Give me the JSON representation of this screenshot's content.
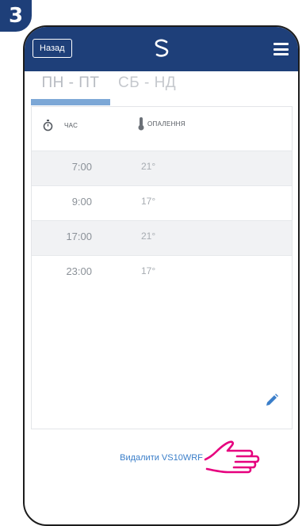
{
  "step_badge": "3",
  "header": {
    "back_label": "Назад",
    "logo_icon": "salus-logo-icon",
    "menu_icon": "hamburger-menu-icon"
  },
  "tabs": [
    {
      "label": "ПН - ПТ",
      "active": true
    },
    {
      "label": "СБ - НД",
      "active": false
    }
  ],
  "columns": {
    "time_label": "ЧАС",
    "heating_label": "ОПАЛЕННЯ"
  },
  "schedule": [
    {
      "time": "7:00",
      "temp": "21°"
    },
    {
      "time": "9:00",
      "temp": "17°"
    },
    {
      "time": "17:00",
      "temp": "21°"
    },
    {
      "time": "23:00",
      "temp": "17°"
    }
  ],
  "delete_link": "Видалити VS10WRF",
  "colors": {
    "header": "#1e3f79",
    "tab_indicator": "#7ca7d6",
    "link": "#3a7ec9",
    "hand": "#e6007e"
  }
}
